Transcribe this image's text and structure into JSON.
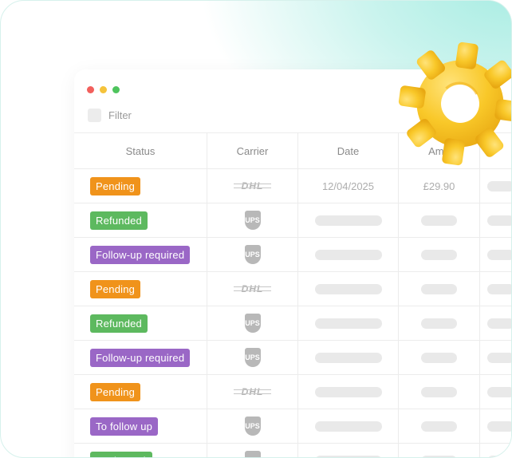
{
  "window_controls": [
    "close",
    "minimize",
    "maximize"
  ],
  "filter": {
    "label": "Filter"
  },
  "table": {
    "headers": {
      "status": "Status",
      "carrier": "Carrier",
      "date": "Date",
      "amount": "Amo"
    },
    "rows": [
      {
        "status": "Pending",
        "status_color": "#f0931b",
        "carrier": "DHL",
        "date": "12/04/2025",
        "amount": "£29.90"
      },
      {
        "status": "Refunded",
        "status_color": "#5db95f",
        "carrier": "UPS",
        "date": "",
        "amount": ""
      },
      {
        "status": "Follow-up required",
        "status_color": "#9a67c6",
        "carrier": "UPS",
        "date": "",
        "amount": ""
      },
      {
        "status": "Pending",
        "status_color": "#f0931b",
        "carrier": "DHL",
        "date": "",
        "amount": ""
      },
      {
        "status": "Refunded",
        "status_color": "#5db95f",
        "carrier": "UPS",
        "date": "",
        "amount": ""
      },
      {
        "status": "Follow-up required",
        "status_color": "#9a67c6",
        "carrier": "UPS",
        "date": "",
        "amount": ""
      },
      {
        "status": "Pending",
        "status_color": "#f0931b",
        "carrier": "DHL",
        "date": "",
        "amount": ""
      },
      {
        "status": "To follow up",
        "status_color": "#9a67c6",
        "carrier": "UPS",
        "date": "",
        "amount": ""
      },
      {
        "status": "remboursé",
        "status_color": "#5db95f",
        "carrier": "UPS",
        "date": "",
        "amount": ""
      }
    ]
  },
  "colors": {
    "dot_red": "#f25f5c",
    "dot_yellow": "#f5c33b",
    "dot_green": "#4ec45d",
    "gear": "#f9c829",
    "background_tint": "#a6ece2"
  },
  "decoration": {
    "icon": "gear-icon"
  }
}
